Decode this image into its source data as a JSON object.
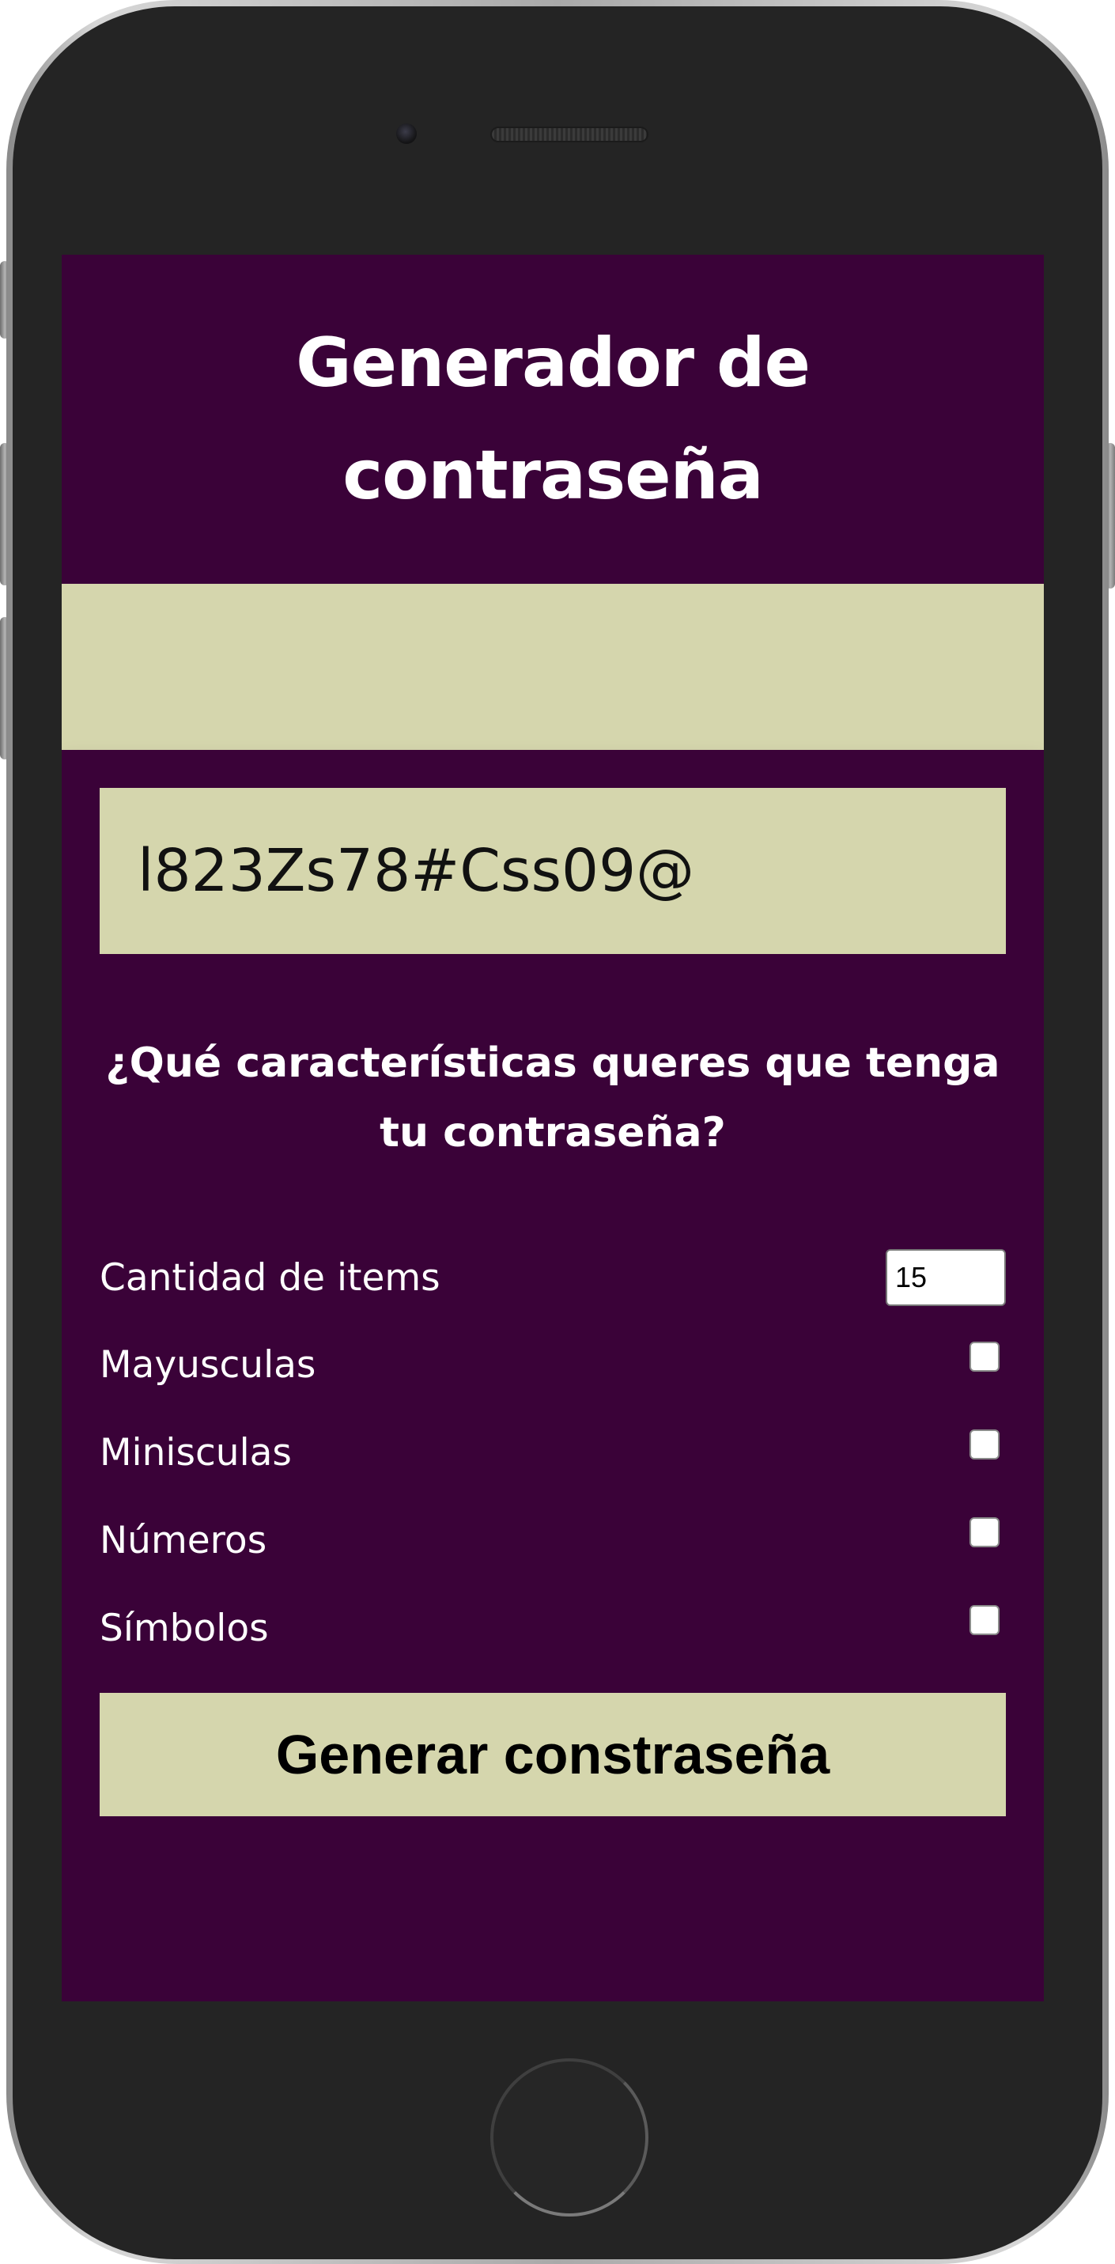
{
  "header": {
    "title": "Generador de contraseña"
  },
  "password": {
    "value": "l823Zs78#Css09@"
  },
  "question": "¿Qué características queres que tenga tu contraseña?",
  "options": {
    "quantity": {
      "label": "Cantidad de items",
      "value": "15"
    },
    "uppercase": {
      "label": "Mayusculas",
      "checked": false
    },
    "lowercase": {
      "label": "Minisculas",
      "checked": false
    },
    "numbers": {
      "label": "Números",
      "checked": false
    },
    "symbols": {
      "label": "Símbolos",
      "checked": false
    }
  },
  "generate_button": {
    "label": "Generar constraseña"
  },
  "colors": {
    "primary": "#3a0238",
    "accent": "#d5d6ad",
    "frame": "#242424"
  }
}
